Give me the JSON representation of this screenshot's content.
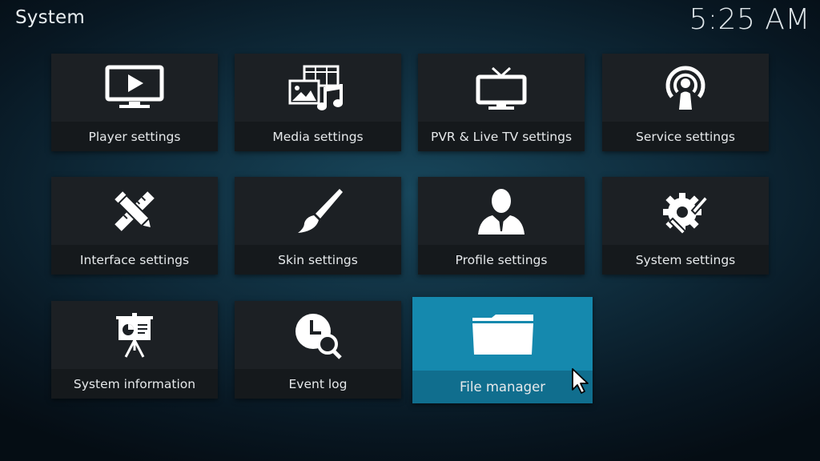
{
  "header": {
    "title": "System",
    "clock": "5:25 AM"
  },
  "tiles": [
    {
      "label": "Player settings",
      "icon": "tv-play-icon"
    },
    {
      "label": "Media settings",
      "icon": "media-icon"
    },
    {
      "label": "PVR & Live TV settings",
      "icon": "tv-antenna-icon"
    },
    {
      "label": "Service settings",
      "icon": "podcast-icon"
    },
    {
      "label": "Interface settings",
      "icon": "pencil-ruler-icon"
    },
    {
      "label": "Skin settings",
      "icon": "paintbrush-icon"
    },
    {
      "label": "Profile settings",
      "icon": "user-icon"
    },
    {
      "label": "System settings",
      "icon": "gear-wrench-icon"
    },
    {
      "label": "System information",
      "icon": "presentation-icon"
    },
    {
      "label": "Event log",
      "icon": "clock-search-icon"
    },
    {
      "label": "File manager",
      "icon": "folder-icon",
      "focused": true
    }
  ],
  "colors": {
    "focus": "#1589ae",
    "focus_band": "#106e8e",
    "tile": "#1c2024"
  }
}
